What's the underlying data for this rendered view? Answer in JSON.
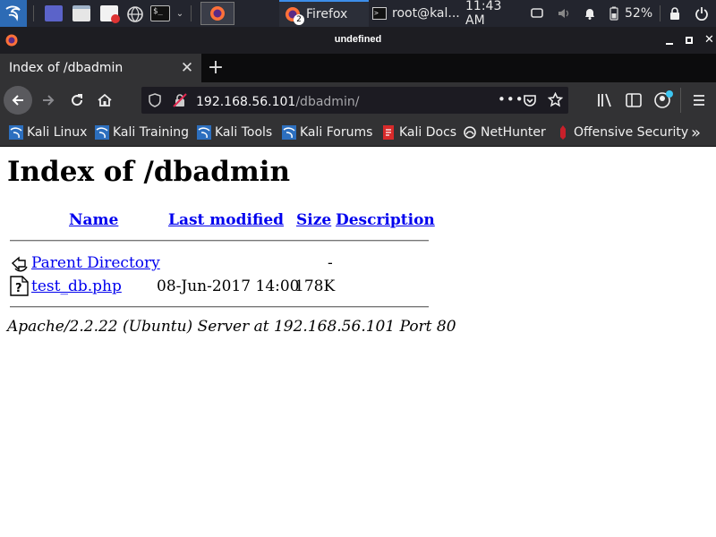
{
  "taskbar": {
    "firefox_task_label": "Firefox",
    "firefox_task_count": "2",
    "terminal_task_label": "root@kal...",
    "clock": "11:43 AM",
    "battery_percent": "52%"
  },
  "window": {
    "title": "undefined"
  },
  "tab": {
    "title": "Index of /dbadmin"
  },
  "urlbar": {
    "host": "192.168.56.101",
    "path": "/dbadmin/"
  },
  "bookmarks": [
    {
      "label": "Kali Linux"
    },
    {
      "label": "Kali Training"
    },
    {
      "label": "Kali Tools"
    },
    {
      "label": "Kali Forums"
    },
    {
      "label": "Kali Docs"
    },
    {
      "label": "NetHunter"
    },
    {
      "label": "Offensive Security"
    }
  ],
  "listing": {
    "heading": "Index of /dbadmin",
    "columns": {
      "name": "Name",
      "last_modified": "Last modified",
      "size": "Size",
      "description": "Description"
    },
    "rows": [
      {
        "name": "Parent Directory",
        "last_modified": "",
        "size": "-",
        "icon": "back-icon"
      },
      {
        "name": "test_db.php",
        "last_modified": "08-Jun-2017 14:00",
        "size": "178K",
        "icon": "unknown-file-icon"
      }
    ],
    "footer": "Apache/2.2.22 (Ubuntu) Server at 192.168.56.101 Port 80"
  },
  "colors": {
    "link": "#0000ee",
    "toolbar": "#323234",
    "taskbar": "#23252e",
    "accent": "#3d8eea"
  }
}
